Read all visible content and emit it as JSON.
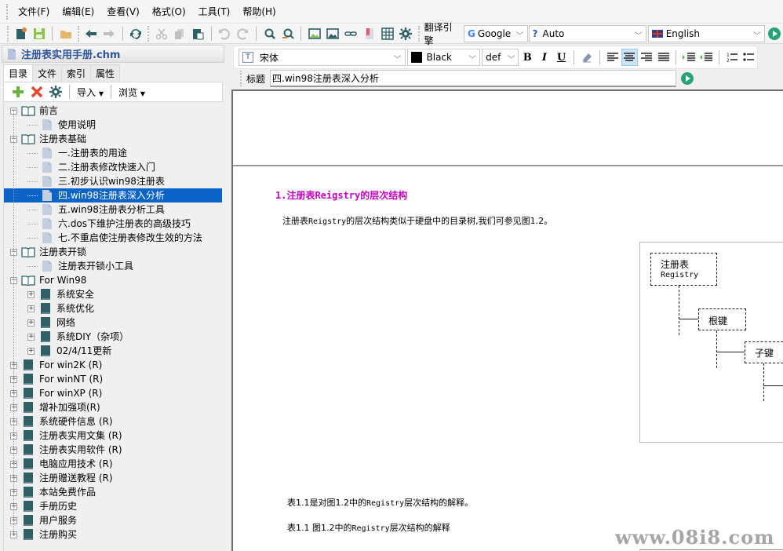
{
  "menu": [
    "文件(F)",
    "编辑(E)",
    "查看(V)",
    "格式(O)",
    "工具(T)",
    "帮助(H)"
  ],
  "toolbar": {
    "translate_label": "翻译引擎",
    "engine": "Google",
    "source_lang": "Auto",
    "target_lang": "English"
  },
  "left": {
    "doc_title": "注册表实用手册.chm",
    "tabs": [
      "目录",
      "文件",
      "索引",
      "属性"
    ],
    "active_tab": "目录",
    "tree_toolbar": {
      "import": "导入",
      "browse": "浏览"
    },
    "tree": [
      {
        "label": "前言",
        "level": 0,
        "type": "book-open",
        "expander": "-"
      },
      {
        "label": "使用说明",
        "level": 1,
        "type": "page"
      },
      {
        "label": "注册表基础",
        "level": 0,
        "type": "book-open",
        "expander": "-"
      },
      {
        "label": "一.注册表的用途",
        "level": 1,
        "type": "page"
      },
      {
        "label": "二.注册表修改快速入门",
        "level": 1,
        "type": "page"
      },
      {
        "label": "三.初步认识win98注册表",
        "level": 1,
        "type": "page"
      },
      {
        "label": "四.win98注册表深入分析",
        "level": 1,
        "type": "page",
        "selected": true
      },
      {
        "label": "五.win98注册表分析工具",
        "level": 1,
        "type": "page"
      },
      {
        "label": "六.dos下维护注册表的高级技巧",
        "level": 1,
        "type": "page"
      },
      {
        "label": "七.不重启使注册表修改生效的方法",
        "level": 1,
        "type": "page"
      },
      {
        "label": "注册表开锁",
        "level": 0,
        "type": "book-open",
        "expander": "-"
      },
      {
        "label": "注册表开锁小工具",
        "level": 1,
        "type": "page"
      },
      {
        "label": "For Win98",
        "level": 0,
        "type": "book-open",
        "expander": "-"
      },
      {
        "label": "系统安全",
        "level": 1,
        "type": "book",
        "expander": "+"
      },
      {
        "label": "系统优化",
        "level": 1,
        "type": "book",
        "expander": "+"
      },
      {
        "label": "网络",
        "level": 1,
        "type": "book",
        "expander": "+"
      },
      {
        "label": "系统DIY（杂项）",
        "level": 1,
        "type": "book",
        "expander": "+"
      },
      {
        "label": "02/4/11更新",
        "level": 1,
        "type": "book",
        "expander": "+"
      },
      {
        "label": "For win2K (R)",
        "level": 0,
        "type": "book",
        "expander": "+"
      },
      {
        "label": "For winNT (R)",
        "level": 0,
        "type": "book",
        "expander": "+"
      },
      {
        "label": "For winXP (R)",
        "level": 0,
        "type": "book",
        "expander": "+"
      },
      {
        "label": "增补加强项(R)",
        "level": 0,
        "type": "book",
        "expander": "+"
      },
      {
        "label": "系统硬件信息 (R)",
        "level": 0,
        "type": "book",
        "expander": "+"
      },
      {
        "label": "注册表实用文集 (R)",
        "level": 0,
        "type": "book",
        "expander": "+"
      },
      {
        "label": "注册表实用软件 (R)",
        "level": 0,
        "type": "book",
        "expander": "+"
      },
      {
        "label": "电脑应用技术 (R)",
        "level": 0,
        "type": "book",
        "expander": "+"
      },
      {
        "label": "注册赠送教程 (R)",
        "level": 0,
        "type": "book",
        "expander": "+"
      },
      {
        "label": "本站免费作品",
        "level": 0,
        "type": "book",
        "expander": "+"
      },
      {
        "label": "手册历史",
        "level": 0,
        "type": "book",
        "expander": "+"
      },
      {
        "label": "用户服务",
        "level": 0,
        "type": "book",
        "expander": "+"
      },
      {
        "label": "注册购买",
        "level": 0,
        "type": "book",
        "expander": "+"
      }
    ]
  },
  "format": {
    "font": "宋体",
    "color_name": "Black",
    "color_hex": "#000000",
    "size": "def",
    "bold": "B",
    "italic": "I",
    "underline": "U",
    "active_align": "center"
  },
  "titlebar": {
    "label": "标题",
    "value": "四.win98注册表深入分析"
  },
  "content": {
    "heading_prefix": "1.注册表",
    "heading_mono": "Reigstry",
    "heading_suffix": "的层次结构",
    "heading_color": "#c000c0",
    "para1_a": "注册表",
    "para1_mono": "Reigstry",
    "para1_b": "的层次结构类似于硬盘中的目录树,我们可参见图1.2。",
    "figure": {
      "root_cn": "注册表",
      "root_en": "Registry",
      "level1": "根键",
      "level2": "子键"
    },
    "para2_a": "表1.1是对图1.2中的",
    "para2_mono": "Registry",
    "para2_b": "层次结构的解释。",
    "para3_a": "表1.1 图1.2中的",
    "para3_mono": "Registry",
    "para3_b": "层次结构的解释"
  },
  "watermark": "www.08i8.com"
}
